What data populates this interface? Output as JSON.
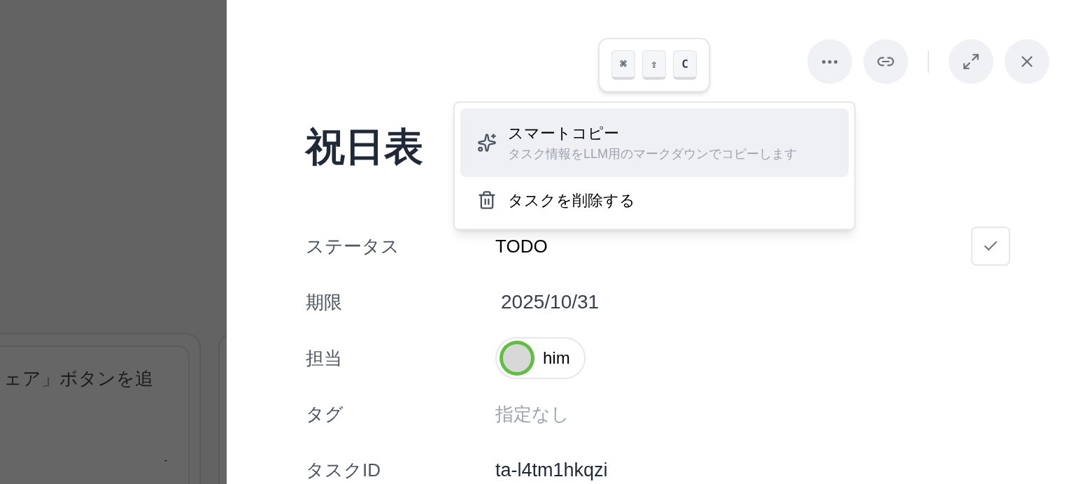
{
  "background_board": {
    "card_text": "ェア」ボタンを追",
    "card_footer": "-"
  },
  "header": {
    "buttons": [
      {
        "kind": "more"
      },
      {
        "kind": "link"
      },
      {
        "kind": "divider"
      },
      {
        "kind": "expand"
      },
      {
        "kind": "close"
      }
    ]
  },
  "shortcut_tooltip": {
    "keys": [
      "⌘",
      "⇧",
      "C"
    ]
  },
  "menu": {
    "items": [
      {
        "kind": "smart",
        "label": "スマートコピー",
        "description": "タスク情報をLLM用のマークダウンでコピーします",
        "selected": true
      },
      {
        "kind": "delete",
        "label": "タスクを削除する",
        "selected": false
      }
    ]
  },
  "task": {
    "title": "祝日表",
    "fields": [
      {
        "kind": "status",
        "label": "ステータス",
        "value": "TODO"
      },
      {
        "kind": "date",
        "label": "期限",
        "value": "2025/10/31"
      },
      {
        "kind": "assignee",
        "label": "担当",
        "value": "him"
      },
      {
        "kind": "empty",
        "label": "タグ",
        "value": "指定なし"
      },
      {
        "kind": "text",
        "label": "タスクID",
        "value": "ta-l4tm1hkqzi"
      }
    ]
  }
}
